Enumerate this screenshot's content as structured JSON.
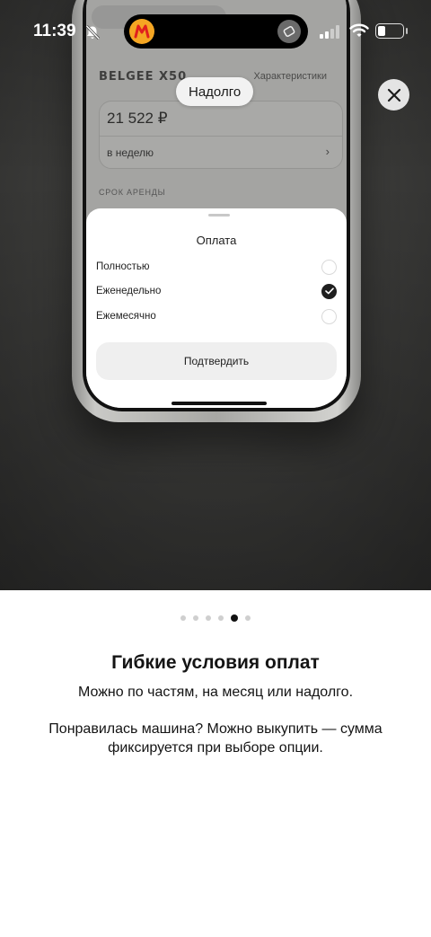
{
  "status_bar": {
    "time": "11:39"
  },
  "phone_app": {
    "car_model": "BELGEE X50",
    "specs_link": "Характеристики",
    "price": "21 522 ₽",
    "period": "в неделю",
    "term_label": "СРОК АРЕНДЫ",
    "sheet": {
      "title": "Оплата",
      "options": [
        {
          "label": "Полностью",
          "selected": false
        },
        {
          "label": "Еженедельно",
          "selected": true
        },
        {
          "label": "Ежемесячно",
          "selected": false
        }
      ],
      "confirm_label": "Подтвердить"
    }
  },
  "overlay": {
    "pill_label": "Надолго"
  },
  "pager": {
    "count": 6,
    "active_index": 4
  },
  "content": {
    "headline": "Гибкие условия оплат",
    "subline": "Можно по частям, на месяц или надолго.",
    "body": "Понравилась машина? Можно выкупить — сумма фиксируется при выборе опции."
  },
  "colors": {
    "accent_dark": "#1f1f1f",
    "app_icon": "#f5a623"
  }
}
